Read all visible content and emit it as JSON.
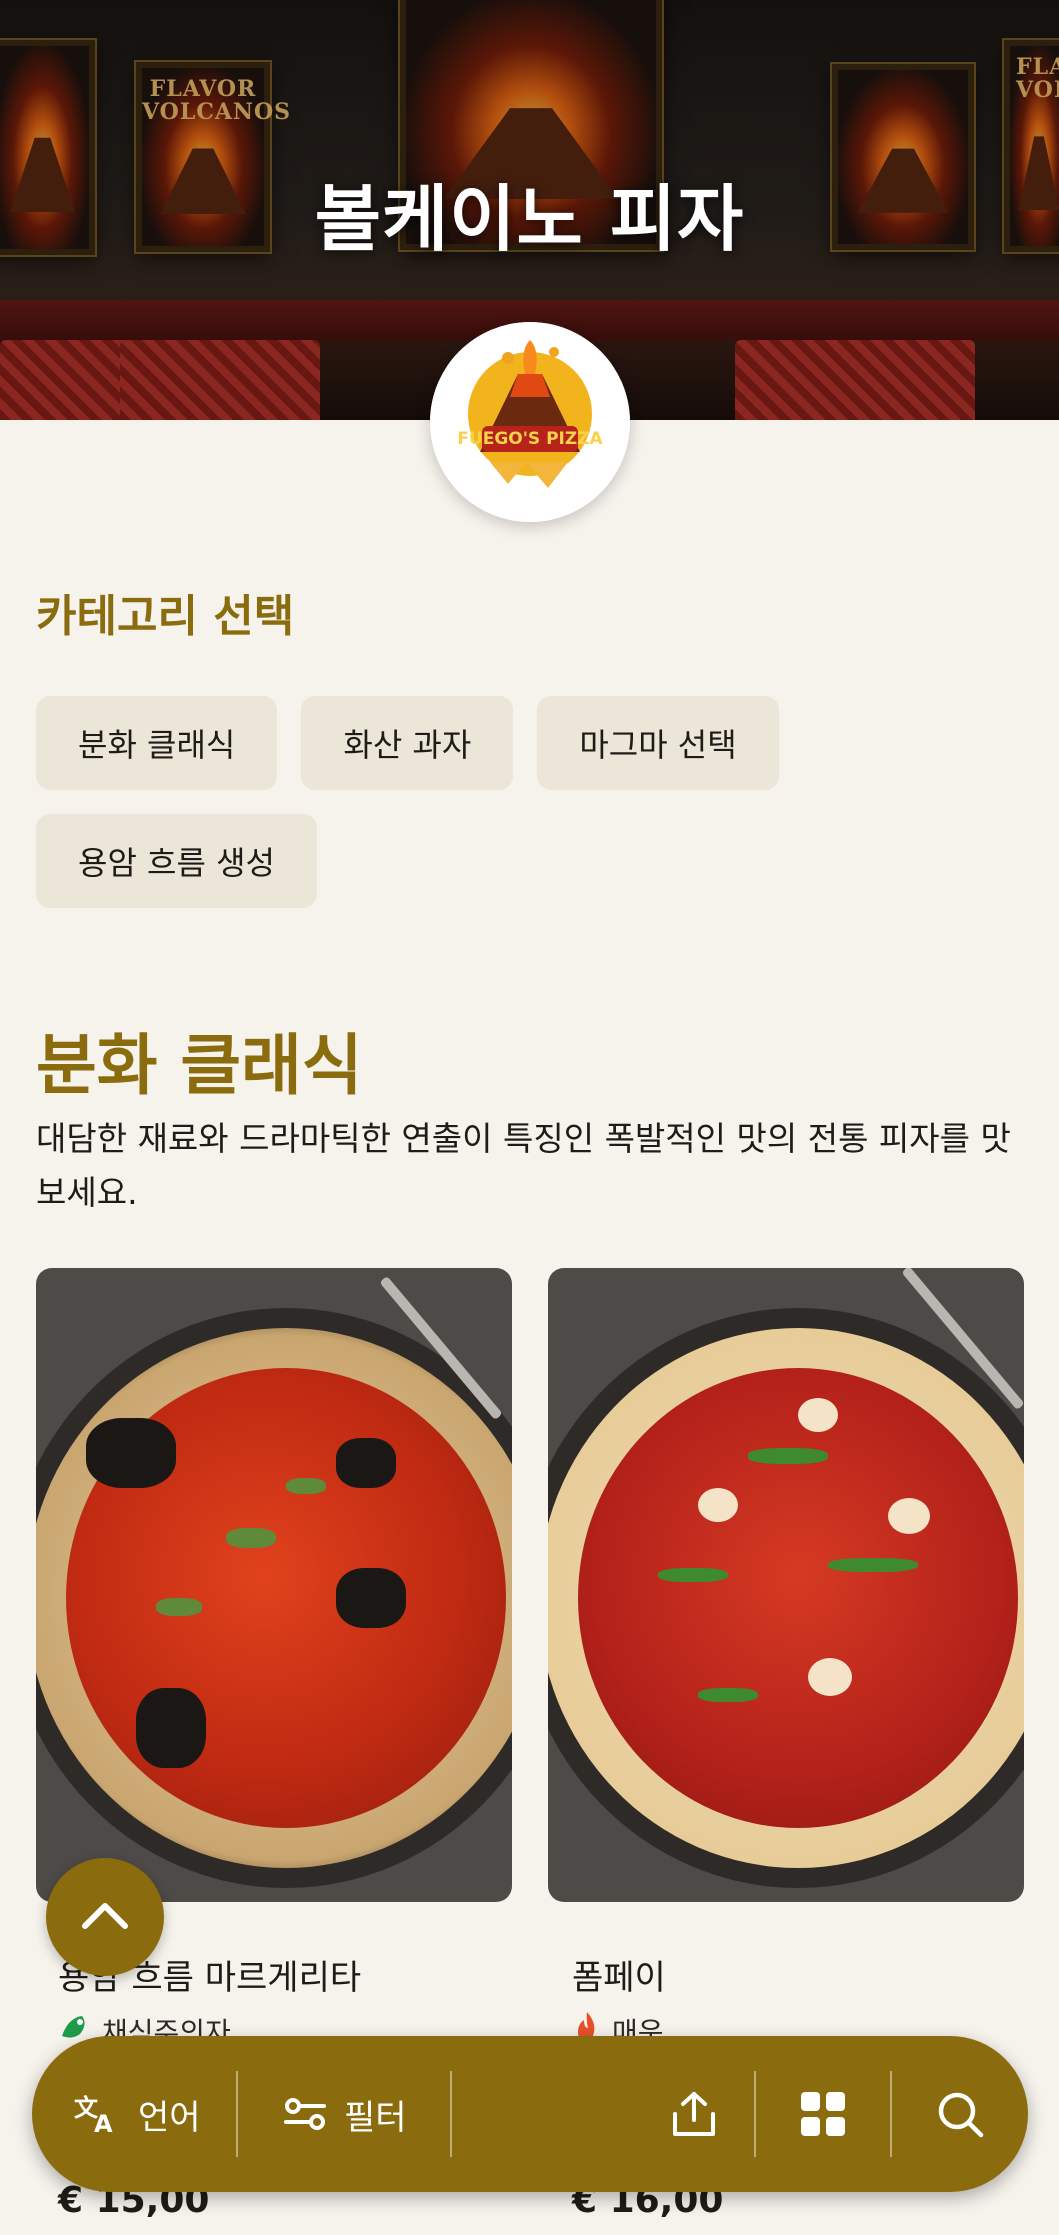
{
  "hero": {
    "title": "볼케이노 피자",
    "poster_left": "FLAVOR VOLCANOS",
    "poster_right": "FLAVOR VOLCANO"
  },
  "logo": {
    "text": "FUEGO'S PIZZA"
  },
  "categories": {
    "title": "카테고리 선택",
    "items": [
      {
        "label": "분화 클래식"
      },
      {
        "label": "화산 과자"
      },
      {
        "label": "마그마 선택"
      },
      {
        "label": "용암 흐름 생성"
      }
    ]
  },
  "section": {
    "title": "분화 클래식",
    "description": "대담한 재료와 드라마틱한 연출이 특징인 폭발적인 맛의 전통 피자를 맛보세요."
  },
  "products": [
    {
      "name": "용암 흐름 마르게리타",
      "tag": "채식주의자",
      "tag_icon": "vegetarian-icon",
      "price": "€ 15,00"
    },
    {
      "name": "폼페이",
      "tag": "매운",
      "tag_icon": "flame-icon",
      "price": "€ 16,00"
    }
  ],
  "bottom_bar": {
    "language_label": "언어",
    "filter_label": "필터"
  },
  "colors": {
    "accent": "#8a6c0e",
    "background": "#f6f2ec",
    "chip": "#ece6d9"
  }
}
